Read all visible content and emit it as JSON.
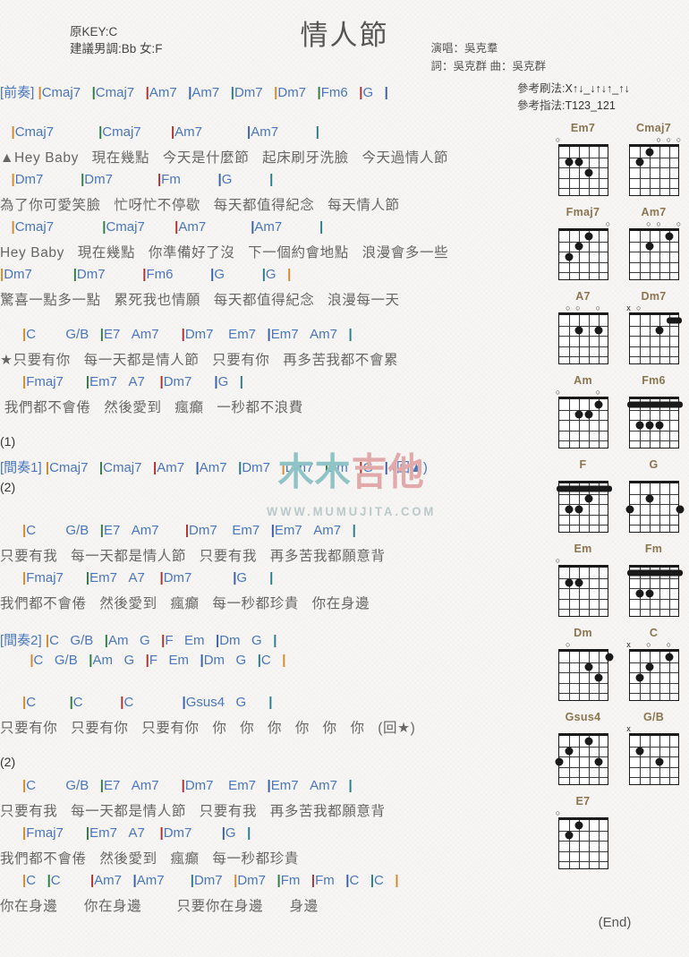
{
  "header": {
    "title": "情人節",
    "key_line1": "原KEY:C",
    "key_line2": "建議男調:Bb 女:F",
    "singer": "演唱：吳克羣",
    "writers": "詞：吳克群   曲：吳克群",
    "strum_label": "參考刷法:",
    "strum_value": "X↑↓_↓↑↓↑_↑↓",
    "finger_label": "參考指法:",
    "finger_value": "T123_121"
  },
  "watermark": {
    "text": "木木吉他",
    "url": "WWW.MUMUJITA.COM"
  },
  "end_label": "(End)",
  "sections": [
    {
      "id": "intro",
      "tag": "[前奏]",
      "lines": [
        {
          "type": "chords",
          "text": "[前奏] |Cmaj7   |Cmaj7   |Am7   |Am7   |Dm7   |Dm7   |Fm6   |G   |"
        }
      ]
    },
    {
      "id": "verse1",
      "lines": [
        {
          "type": "chords",
          "text": "   |Cmaj7            |Cmaj7        |Am7            |Am7          |"
        },
        {
          "type": "lyrics",
          "text": "▲Hey Baby   現在幾點   今天是什麼節   起床刷牙洗臉   今天過情人節"
        },
        {
          "type": "chords",
          "text": "   |Dm7          |Dm7            |Fm          |G          |"
        },
        {
          "type": "lyrics",
          "text": "為了你可愛笑臉   忙呀忙不停歇   每天都值得紀念   每天情人節"
        },
        {
          "type": "chords",
          "text": "   |Cmaj7             |Cmaj7        |Am7            |Am7          |"
        },
        {
          "type": "lyrics",
          "text": "Hey Baby   現在幾點   你準備好了沒   下一個約會地點   浪漫會多一些"
        },
        {
          "type": "chords",
          "text": "|Dm7           |Dm7          |Fm6          |G          |G   |"
        },
        {
          "type": "lyrics",
          "text": "驚喜一點多一點   累死我也情願   每天都值得紀念   浪漫每一天"
        }
      ]
    },
    {
      "id": "chorus1",
      "lines": [
        {
          "type": "chords",
          "text": "      |C        G/B   |E7   Am7      |Dm7    Em7   |Em7   Am7   |"
        },
        {
          "type": "lyrics",
          "text": "★只要有你   每一天都是情人節   只要有你   再多苦我都不會累"
        },
        {
          "type": "chords",
          "text": "      |Fmaj7      |Em7   A7    |Dm7      |G   |"
        },
        {
          "type": "lyrics",
          "text": " 我們都不會倦   然後愛到   瘋癲   一秒都不浪費"
        }
      ]
    },
    {
      "id": "interlude1",
      "lines": [
        {
          "type": "num",
          "text": "(1)"
        },
        {
          "type": "chords",
          "text": "[間奏1] |Cmaj7   |Cmaj7   |Am7   |Am7   |Dm7   |Dm7   |Fm   |G   | (回▲)"
        },
        {
          "type": "num",
          "text": "(2)"
        }
      ]
    },
    {
      "id": "chorus2",
      "lines": [
        {
          "type": "chords",
          "text": "      |C        G/B   |E7   Am7       |Dm7    Em7   |Em7   Am7   |"
        },
        {
          "type": "lyrics",
          "text": "只要有我   每一天都是情人節   只要有我   再多苦我都願意背"
        },
        {
          "type": "chords",
          "text": "      |Fmaj7      |Em7   A7    |Dm7           |G      |"
        },
        {
          "type": "lyrics",
          "text": "我們都不會倦   然後愛到   瘋癲   每一秒都珍貴   你在身邊"
        }
      ]
    },
    {
      "id": "interlude2",
      "lines": [
        {
          "type": "chords",
          "text": "[間奏2] |C   G/B   |Am   G   |F   Em   |Dm   G   |"
        },
        {
          "type": "chords",
          "text": "        |C   G/B   |Am   G   |F   Em   |Dm   G   |C   |"
        }
      ]
    },
    {
      "id": "breakdown",
      "lines": [
        {
          "type": "chords",
          "text": "      |C         |C          |C             |Gsus4   G      |"
        },
        {
          "type": "lyrics",
          "text": "只要有你   只要有你   只要有你   你   你   你   你   你   你   (回★)"
        }
      ]
    },
    {
      "id": "chorus3",
      "lines": [
        {
          "type": "num",
          "text": "(2)"
        },
        {
          "type": "chords",
          "text": "      |C        G/B   |E7   Am7      |Dm7    Em7   |Em7   Am7   |"
        },
        {
          "type": "lyrics",
          "text": "只要有我   每一天都是情人節   只要有我   再多苦我都願意背"
        },
        {
          "type": "chords",
          "text": "      |Fmaj7      |Em7   A7    |Dm7        |G   |"
        },
        {
          "type": "lyrics",
          "text": "我們都不會倦   然後愛到   瘋癲   每一秒都珍貴"
        },
        {
          "type": "chords",
          "text": "      |C   |C        |Am7   |Am7       |Dm7   |Dm7   |Fm   |Fm   |C   |C   |"
        },
        {
          "type": "lyrics",
          "text": "你在身邊      你在身邊        只要你在身邊      身邊"
        }
      ]
    }
  ],
  "chord_diagrams": [
    {
      "name": "Em7",
      "markers": [
        "o",
        "",
        "",
        "",
        "",
        ""
      ],
      "dots": [
        [
          2,
          2
        ],
        [
          3,
          2
        ],
        [
          4,
          3
        ]
      ],
      "barres": []
    },
    {
      "name": "Cmaj7",
      "markers": [
        "",
        "",
        "",
        "o",
        "o",
        "o"
      ],
      "dots": [
        [
          2,
          2
        ],
        [
          3,
          1
        ]
      ],
      "barres": []
    },
    {
      "name": "Fmaj7",
      "markers": [
        "",
        "",
        "",
        "",
        "",
        "o"
      ],
      "dots": [
        [
          2,
          3
        ],
        [
          3,
          2
        ],
        [
          4,
          1
        ]
      ],
      "barres": []
    },
    {
      "name": "Am7",
      "markers": [
        "",
        "",
        "o",
        "o",
        "",
        "o"
      ],
      "dots": [
        [
          3,
          2
        ],
        [
          5,
          1
        ]
      ],
      "barres": []
    },
    {
      "name": "A7",
      "markers": [
        "",
        "o",
        "o",
        "",
        "o",
        ""
      ],
      "dots": [
        [
          3,
          2
        ],
        [
          5,
          2
        ]
      ],
      "barres": []
    },
    {
      "name": "Dm7",
      "markers": [
        "x",
        "o",
        "",
        "",
        "",
        ""
      ],
      "dots": [
        [
          4,
          2
        ]
      ],
      "barres": [
        [
          5,
          6,
          1
        ]
      ]
    },
    {
      "name": "Am",
      "markers": [
        "o",
        "",
        "",
        "",
        "o",
        ""
      ],
      "dots": [
        [
          5,
          1
        ],
        [
          3,
          2
        ],
        [
          4,
          2
        ]
      ],
      "barres": []
    },
    {
      "name": "Fm6",
      "markers": [
        "",
        "",
        "",
        "",
        "",
        ""
      ],
      "dots": [
        [
          2,
          3
        ],
        [
          3,
          3
        ],
        [
          4,
          3
        ]
      ],
      "barres": [
        [
          1,
          6,
          1
        ]
      ]
    },
    {
      "name": "F",
      "markers": [
        "",
        "",
        "",
        "",
        "",
        ""
      ],
      "dots": [
        [
          4,
          2
        ],
        [
          2,
          3
        ],
        [
          3,
          3
        ]
      ],
      "barres": [
        [
          1,
          6,
          1
        ]
      ]
    },
    {
      "name": "G",
      "markers": [
        "",
        "",
        "",
        "",
        "",
        ""
      ],
      "dots": [
        [
          3,
          2
        ],
        [
          1,
          3
        ],
        [
          6,
          3
        ]
      ],
      "barres": []
    },
    {
      "name": "Em",
      "markers": [
        "o",
        "",
        "",
        "",
        "",
        ""
      ],
      "dots": [
        [
          2,
          2
        ],
        [
          3,
          2
        ]
      ],
      "barres": []
    },
    {
      "name": "Fm",
      "markers": [
        "",
        "",
        "",
        "",
        "",
        ""
      ],
      "dots": [
        [
          2,
          3
        ],
        [
          3,
          3
        ]
      ],
      "barres": [
        [
          1,
          6,
          1
        ]
      ]
    },
    {
      "name": "Dm",
      "markers": [
        "",
        "o",
        "",
        "",
        "",
        ""
      ],
      "dots": [
        [
          6,
          1
        ],
        [
          4,
          2
        ],
        [
          5,
          3
        ]
      ],
      "barres": []
    },
    {
      "name": "C",
      "markers": [
        "x",
        "",
        "o",
        "",
        "o",
        ""
      ],
      "dots": [
        [
          5,
          1
        ],
        [
          3,
          2
        ],
        [
          2,
          3
        ]
      ],
      "barres": []
    },
    {
      "name": "Gsus4",
      "markers": [
        "",
        "",
        "",
        "",
        "",
        ""
      ],
      "dots": [
        [
          4,
          1
        ],
        [
          2,
          2
        ],
        [
          1,
          3
        ],
        [
          5,
          3
        ]
      ],
      "barres": []
    },
    {
      "name": "G/B",
      "markers": [
        "x",
        "",
        "",
        "",
        "",
        ""
      ],
      "dots": [
        [
          2,
          2
        ],
        [
          4,
          3
        ]
      ],
      "barres": []
    },
    {
      "name": "E7",
      "markers": [
        "o",
        "",
        "",
        "",
        "",
        ""
      ],
      "dots": [
        [
          3,
          1
        ],
        [
          2,
          2
        ]
      ],
      "barres": []
    }
  ]
}
